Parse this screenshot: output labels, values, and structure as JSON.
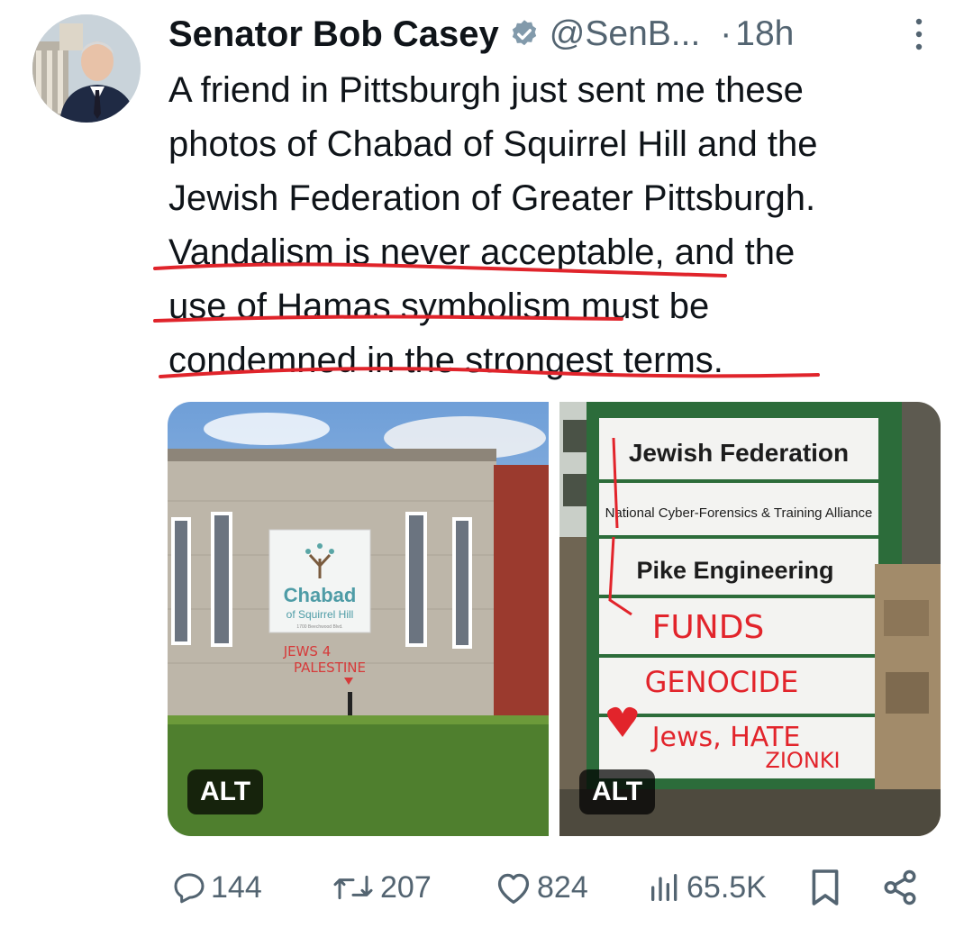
{
  "author": {
    "name": "Senator Bob Casey",
    "handle": "@SenB...",
    "time": "18h",
    "separator": "·"
  },
  "tweet": {
    "lines": [
      "A friend in Pittsburgh just sent me these",
      "photos of Chabad of Squirrel Hill and the",
      "Jewish Federation of Greater Pittsburgh.",
      "Vandalism is never acceptable, and the",
      "use of Hamas symbolism must be",
      "condemned in the strongest terms."
    ]
  },
  "media": [
    {
      "alt_label": "ALT",
      "banner_title": "Chabad",
      "banner_subtitle": "of Squirrel Hill",
      "banner_address": "1700 Beechwood Blvd.",
      "graffiti": [
        "JEWS 4",
        "PALESTINE"
      ]
    },
    {
      "alt_label": "ALT",
      "sign_rows": [
        "Jewish Federation",
        "National Cyber-Forensics & Training Alliance",
        "Pike Engineering"
      ],
      "graffiti": [
        "FUNDS",
        "GENOCIDE",
        "Jews, HATE",
        "ZIONKI"
      ]
    }
  ],
  "actions": {
    "replies": "144",
    "reposts": "207",
    "likes": "824",
    "views": "65.5K"
  },
  "colors": {
    "text": "#0f1419",
    "secondary": "#536471",
    "verified": "#829aab",
    "annotation": "#e0242b"
  }
}
